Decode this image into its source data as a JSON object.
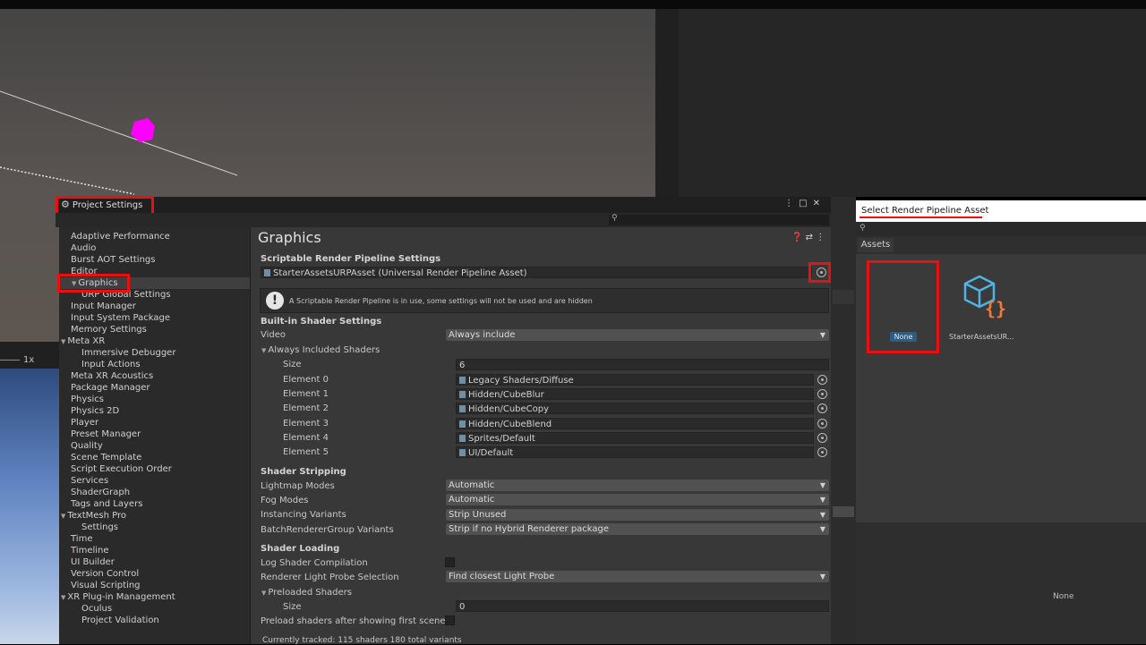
{
  "scene": {
    "zoom_label": "1x"
  },
  "project_settings": {
    "title": "Project Settings",
    "sidebar": [
      {
        "label": "Adaptive Performance"
      },
      {
        "label": "Audio"
      },
      {
        "label": "Burst AOT Settings"
      },
      {
        "label": "Editor"
      },
      {
        "label": "Graphics",
        "selected": true
      },
      {
        "label": "URP Global Settings",
        "child": true
      },
      {
        "label": "Input Manager"
      },
      {
        "label": "Input System Package"
      },
      {
        "label": "Memory Settings"
      },
      {
        "label": "Meta XR",
        "expanded": true
      },
      {
        "label": "Immersive Debugger",
        "child": true
      },
      {
        "label": "Input Actions",
        "child": true
      },
      {
        "label": "Meta XR Acoustics"
      },
      {
        "label": "Package Manager"
      },
      {
        "label": "Physics"
      },
      {
        "label": "Physics 2D"
      },
      {
        "label": "Player"
      },
      {
        "label": "Preset Manager"
      },
      {
        "label": "Quality"
      },
      {
        "label": "Scene Template"
      },
      {
        "label": "Script Execution Order"
      },
      {
        "label": "Services"
      },
      {
        "label": "ShaderGraph"
      },
      {
        "label": "Tags and Layers"
      },
      {
        "label": "TextMesh Pro",
        "expanded": true
      },
      {
        "label": "Settings",
        "child": true
      },
      {
        "label": "Time"
      },
      {
        "label": "Timeline"
      },
      {
        "label": "UI Builder"
      },
      {
        "label": "Version Control"
      },
      {
        "label": "Visual Scripting"
      },
      {
        "label": "XR Plug-in Management",
        "expanded": true
      },
      {
        "label": "Oculus",
        "child": true
      },
      {
        "label": "Project Validation",
        "child": true
      }
    ],
    "main": {
      "heading": "Graphics",
      "srp_section": "Scriptable Render Pipeline Settings",
      "srp_asset": "StarterAssetsURPAsset (Universal Render Pipeline Asset)",
      "help_message": "A Scriptable Render Pipeline is in use, some settings will not be used and are hidden",
      "builtin_section": "Built-in Shader Settings",
      "video_label": "Video",
      "video_value": "Always include",
      "always_included_label": "Always Included Shaders",
      "size_label": "Size",
      "size_value": "6",
      "elements": [
        {
          "label": "Element 0",
          "value": "Legacy Shaders/Diffuse"
        },
        {
          "label": "Element 1",
          "value": "Hidden/CubeBlur"
        },
        {
          "label": "Element 2",
          "value": "Hidden/CubeCopy"
        },
        {
          "label": "Element 3",
          "value": "Hidden/CubeBlend"
        },
        {
          "label": "Element 4",
          "value": "Sprites/Default"
        },
        {
          "label": "Element 5",
          "value": "UI/Default"
        }
      ],
      "stripping_section": "Shader Stripping",
      "stripping": [
        {
          "label": "Lightmap Modes",
          "value": "Automatic"
        },
        {
          "label": "Fog Modes",
          "value": "Automatic"
        },
        {
          "label": "Instancing Variants",
          "value": "Strip Unused"
        },
        {
          "label": "BatchRendererGroup Variants",
          "value": "Strip if no Hybrid Renderer package"
        }
      ],
      "loading_section": "Shader Loading",
      "log_compilation_label": "Log Shader Compilation",
      "light_probe_label": "Renderer Light Probe Selection",
      "light_probe_value": "Find closest Light Probe",
      "preloaded_label": "Preloaded Shaders",
      "preloaded_size_label": "Size",
      "preloaded_size_value": "0",
      "preload_after_label": "Preload shaders after showing first scene",
      "tracked_text": "Currently tracked: 115 shaders 180 total variants"
    }
  },
  "selector": {
    "title": "Select Render Pipeline Asset",
    "tab": "Assets",
    "none_label": "None",
    "asset_label": "StarterAssetsUR...",
    "bottom_none": "None"
  },
  "colors": {
    "highlight_red": "#e81010",
    "selection_blue": "#2c5d87",
    "asset_icon_blue": "#4fb3e6",
    "asset_icon_orange": "#f07a3a",
    "gizmo_magenta": "#ff00ff"
  }
}
